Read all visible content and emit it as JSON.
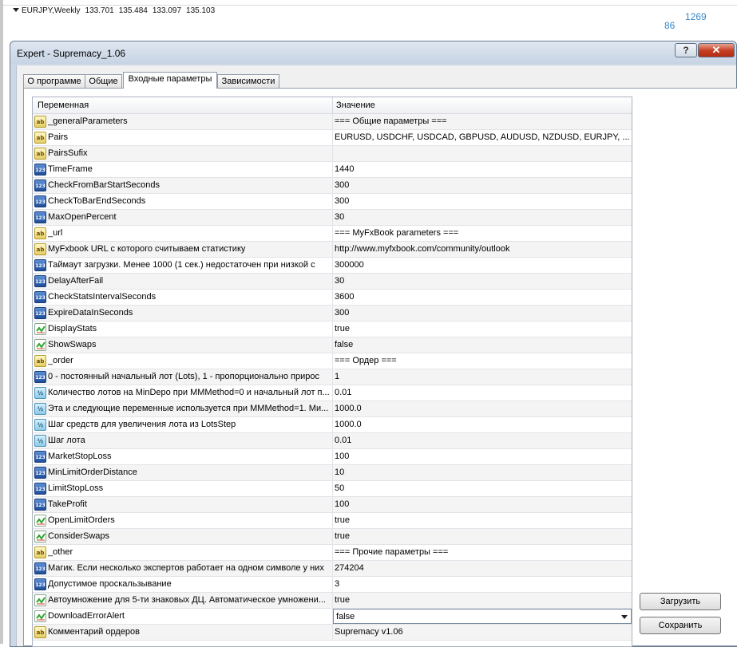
{
  "chart": {
    "symbol": "EURJPY,Weekly",
    "prices": [
      "133.701",
      "135.484",
      "133.097",
      "135.103"
    ],
    "label_a": "86",
    "label_b": "1269"
  },
  "dialog": {
    "title": "Expert - Supremacy_1.06",
    "help_label": "?",
    "close_label": "✕",
    "tabs": [
      "О программе",
      "Общие",
      "Входные параметры",
      "Зависимости"
    ],
    "active_tab": "Входные параметры",
    "columns": {
      "variable": "Переменная",
      "value": "Значение"
    },
    "rows": [
      {
        "type": "ab",
        "name": "_generalParameters",
        "value": "=== Общие параметры ==="
      },
      {
        "type": "ab",
        "name": "Pairs",
        "value": "EURUSD, USDCHF, USDCAD, GBPUSD, AUDUSD, NZDUSD, EURJPY, ..."
      },
      {
        "type": "ab",
        "name": "PairsSufix",
        "value": ""
      },
      {
        "type": "123",
        "name": "TimeFrame",
        "value": "1440"
      },
      {
        "type": "123",
        "name": "CheckFromBarStartSeconds",
        "value": "300"
      },
      {
        "type": "123",
        "name": "CheckToBarEndSeconds",
        "value": "300"
      },
      {
        "type": "123",
        "name": "MaxOpenPercent",
        "value": "30"
      },
      {
        "type": "ab",
        "name": "_url",
        "value": "=== MyFxBook parameters ==="
      },
      {
        "type": "ab",
        "name": "MyFxbook URL с которого считываем статистику",
        "value": "http://www.myfxbook.com/community/outlook"
      },
      {
        "type": "123",
        "name": "Таймаут загрузки. Менее 1000 (1 сек.) недостаточен при низкой с",
        "value": "300000"
      },
      {
        "type": "123",
        "name": "DelayAfterFail",
        "value": "30"
      },
      {
        "type": "123",
        "name": "CheckStatsIntervalSeconds",
        "value": "3600"
      },
      {
        "type": "123",
        "name": "ExpireDataInSeconds",
        "value": "300"
      },
      {
        "type": "bool",
        "name": "DisplayStats",
        "value": "true"
      },
      {
        "type": "bool",
        "name": "ShowSwaps",
        "value": "false"
      },
      {
        "type": "ab",
        "name": "_order",
        "value": "=== Ордер ==="
      },
      {
        "type": "123",
        "name": "0 - постоянный начальный лот (Lots), 1 - пропорционально прирос",
        "value": "1"
      },
      {
        "type": "dbl",
        "name": "Количество лотов на MinDepo при MMMethod=0 и начальный лот п...",
        "value": "0.01"
      },
      {
        "type": "dbl",
        "name": "Эта и следующие переменные используется при MMMethod=1. Ми...",
        "value": "1000.0"
      },
      {
        "type": "dbl",
        "name": "Шаг средств для увеличения лота из LotsStep",
        "value": "1000.0"
      },
      {
        "type": "dbl",
        "name": "Шаг лота",
        "value": "0.01"
      },
      {
        "type": "123",
        "name": "MarketStopLoss",
        "value": "100"
      },
      {
        "type": "123",
        "name": "MinLimitOrderDistance",
        "value": "10"
      },
      {
        "type": "123",
        "name": "LimitStopLoss",
        "value": "50"
      },
      {
        "type": "123",
        "name": "TakeProfit",
        "value": "100"
      },
      {
        "type": "bool",
        "name": "OpenLimitOrders",
        "value": "true"
      },
      {
        "type": "bool",
        "name": "ConsiderSwaps",
        "value": "true"
      },
      {
        "type": "ab",
        "name": "_other",
        "value": "=== Прочие параметры ==="
      },
      {
        "type": "123",
        "name": "Магик. Если несколько экспертов работает на одном символе у них",
        "value": "274204"
      },
      {
        "type": "123",
        "name": "Допустимое проскальзывание",
        "value": "3"
      },
      {
        "type": "bool",
        "name": "Автоумножение для 5-ти знаковых ДЦ. Автоматическое умножени...",
        "value": "true"
      },
      {
        "type": "bool",
        "name": "DownloadErrorAlert",
        "value": "false",
        "select": true
      },
      {
        "type": "ab",
        "name": "Комментарий ордеров",
        "value": "Supremacy v1.06"
      }
    ],
    "buttons": {
      "load": "Загрузить",
      "save": "Сохранить"
    }
  },
  "icon_names": {
    "ab": "string-type-icon",
    "123": "integer-type-icon",
    "dbl": "double-type-icon",
    "bool": "boolean-type-icon"
  },
  "icon_text": {
    "ab": "ab",
    "123": "123",
    "dbl": "½"
  }
}
